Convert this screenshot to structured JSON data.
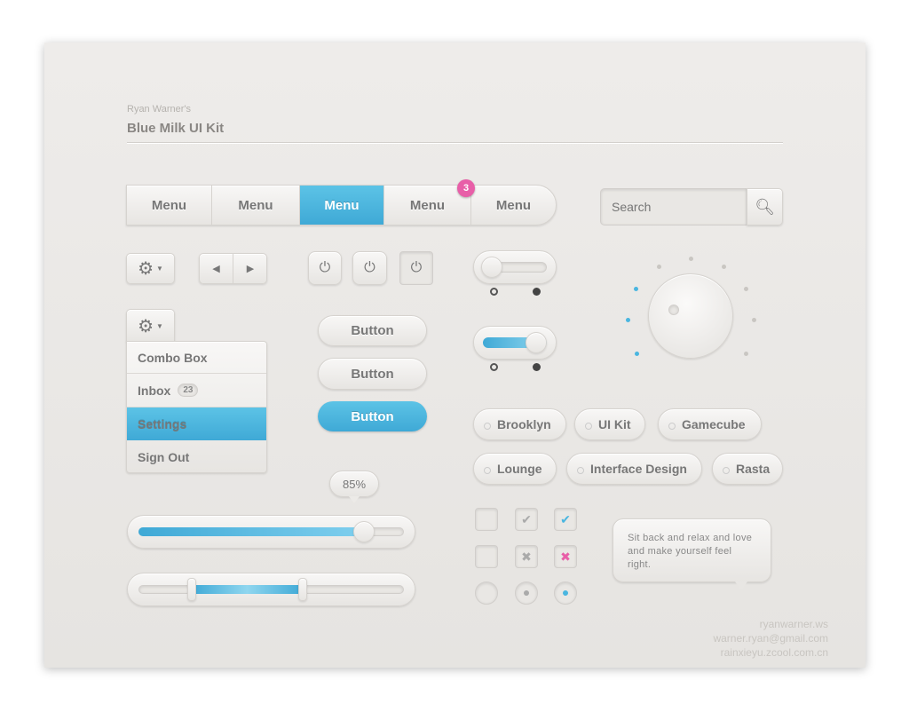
{
  "header": {
    "author": "Ryan Warner's",
    "title": "Blue Milk UI Kit"
  },
  "menu": {
    "items": [
      "Menu",
      "Menu",
      "Menu",
      "Menu",
      "Menu"
    ],
    "active_index": 2,
    "badge": "3"
  },
  "search": {
    "placeholder": "Search"
  },
  "combo": {
    "items": [
      {
        "label": "Combo Box"
      },
      {
        "label": "Inbox",
        "count": "23"
      },
      {
        "label": "Settings"
      },
      {
        "label": "Sign Out"
      }
    ],
    "active_index": 2
  },
  "buttons": [
    "Button",
    "Button",
    "Button"
  ],
  "tags": [
    "Brooklyn",
    "UI Kit",
    "Gamecube",
    "Lounge",
    "Interface Design",
    "Rasta"
  ],
  "slider": {
    "tooltip": "85%",
    "value": 85
  },
  "range": {
    "low": 20,
    "high": 62
  },
  "bubble": {
    "text": "Sit back and relax and love and make yourself feel right."
  },
  "contacts": [
    "ryanwarner.ws",
    "warner.ryan@gmail.com",
    "rainxieyu.zcool.com.cn"
  ],
  "colors": {
    "accent": "#4ab6e0",
    "badge": "#e85fa8",
    "background": "#ebe9e7"
  }
}
